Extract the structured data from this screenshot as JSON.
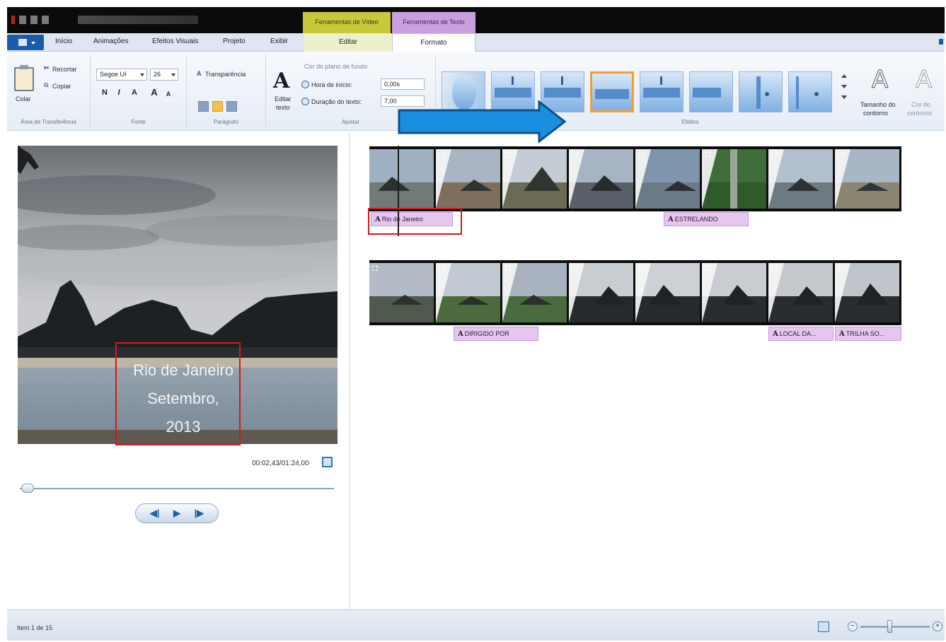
{
  "ribbon_tabs": {
    "context_video": "Ferramentas de Vídeo",
    "context_text": "Ferramentas de Texto",
    "items": [
      "Início",
      "Animações",
      "Efeitos Visuais",
      "Projeto",
      "Exibir"
    ],
    "editar": "Editar",
    "formato": "Formato"
  },
  "clipboard": {
    "paste": "Colar",
    "cut": "Recortar",
    "copy": "Copiar",
    "group": "Área de Transferência"
  },
  "font": {
    "family": "Segoe UI",
    "size": "26",
    "bold": "N",
    "italic": "I",
    "color": "A",
    "grow": "A",
    "shrink": "A",
    "group": "Fonte"
  },
  "paragraph": {
    "transparency": "Transparência",
    "group": "Parágrafo"
  },
  "adjust": {
    "edit_text_1": "Editar",
    "edit_text_2": "texto",
    "bg_color": "Cor do plano de fundo",
    "start_time_label": "Hora de início:",
    "start_time_value": "0,00s",
    "duration_label": "Duração do texto:",
    "duration_value": "7,00",
    "group": "Ajustar"
  },
  "effects": {
    "group": "Efeitos",
    "outline_size_1": "Tamanho do",
    "outline_size_2": "contorno",
    "outline_color_1": "Cor do",
    "outline_color_2": "contorno"
  },
  "preview": {
    "overlay_line1": "Rio de Janeiro",
    "overlay_line2": "Setembro,",
    "overlay_line3": "2013",
    "timecode": "00:02,43/01:24,00"
  },
  "captions": [
    {
      "label": "Rio de Janeiro"
    },
    {
      "label": "ESTRELANDO"
    },
    {
      "label": "DIRIGIDO POR"
    },
    {
      "label": "LOCAL DA..."
    },
    {
      "label": "TRILHA SO..."
    }
  ],
  "status": {
    "item": "Item 1 de 15"
  },
  "colors": {
    "accent": "#1e5aa8",
    "context_video": "#c9c83a",
    "context_text": "#c8a0e0",
    "caption": "#e6c6ef",
    "highlight": "#d11a1a",
    "arrow": "#1a8fe0"
  }
}
